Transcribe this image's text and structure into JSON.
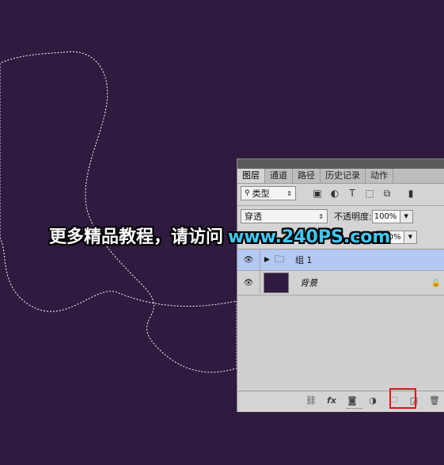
{
  "panel": {
    "tabs": [
      "图层",
      "通道",
      "路径",
      "历史记录",
      "动作"
    ],
    "filter": {
      "kind_label": "类型",
      "icons": [
        "image-filter-icon",
        "adjustment-filter-icon",
        "type-filter-icon",
        "shape-filter-icon",
        "smart-object-filter-icon",
        "filter-toggle-icon"
      ]
    },
    "blend_mode": "穿透",
    "opacity_label": "不透明度:",
    "opacity_value": "100%",
    "fill_value": "100%",
    "layers": [
      {
        "name": "组 1",
        "type": "group",
        "selected": true
      },
      {
        "name": "背景",
        "type": "background",
        "locked": true
      }
    ],
    "bottom_icons": [
      "link-layers-icon",
      "fx-icon",
      "add-mask-icon",
      "adjustment-layer-icon",
      "new-group-icon",
      "new-layer-icon",
      "delete-icon"
    ],
    "fx_label": "fx"
  },
  "watermark": {
    "text": "更多精品教程，请访问",
    "url": "www.240PS.com"
  },
  "colors": {
    "canvas_bg": "#2f1a40",
    "selected_layer": "#b4c9f2",
    "highlight": "#e0141a",
    "url_color": "#3fc9f5"
  }
}
